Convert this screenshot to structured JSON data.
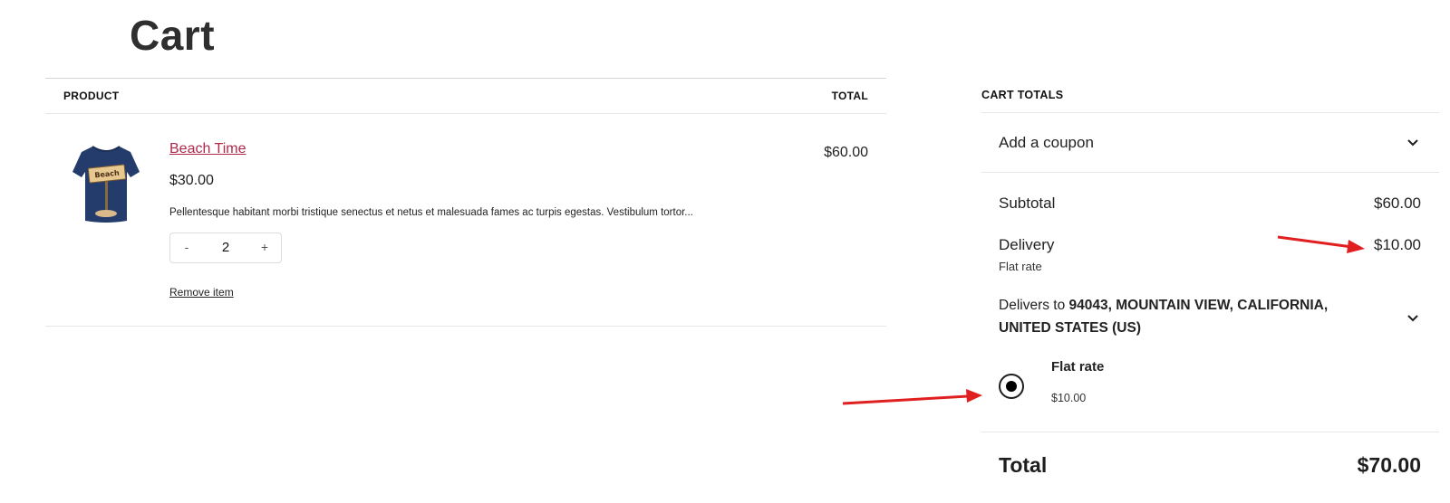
{
  "page": {
    "title": "Cart"
  },
  "cart_table": {
    "headers": {
      "product": "PRODUCT",
      "total": "TOTAL"
    },
    "items": [
      {
        "name": "Beach Time",
        "price": "$30.00",
        "description": "Pellentesque habitant morbi tristique senectus et netus et malesuada fames ac turpis egestas. Vestibulum tortor...",
        "quantity": "2",
        "decrement_label": "-",
        "increment_label": "+",
        "remove_label": "Remove item",
        "line_total": "$60.00",
        "image": {
          "icon": "tshirt-image",
          "sign_text": "Beach"
        }
      }
    ]
  },
  "cart_totals": {
    "title": "CART TOTALS",
    "coupon_label": "Add a coupon",
    "subtotal_label": "Subtotal",
    "subtotal_value": "$60.00",
    "delivery_label": "Delivery",
    "delivery_method": "Flat rate",
    "delivery_value": "$10.00",
    "delivers_to_prefix": "Delivers to ",
    "delivers_to_address": "94043, MOUNTAIN VIEW, CALIFORNIA, UNITED STATES (US)",
    "shipping_option": {
      "name": "Flat rate",
      "price": "$10.00",
      "selected": true
    },
    "total_label": "Total",
    "total_value": "$70.00"
  },
  "colors": {
    "link": "#b0284a",
    "annotation_arrow": "#e02020",
    "shirt": "#243c6b"
  },
  "icons": {
    "coupon_toggle": "chevron-down-icon",
    "address_toggle": "chevron-down-icon",
    "annotation": "arrow-icon"
  }
}
